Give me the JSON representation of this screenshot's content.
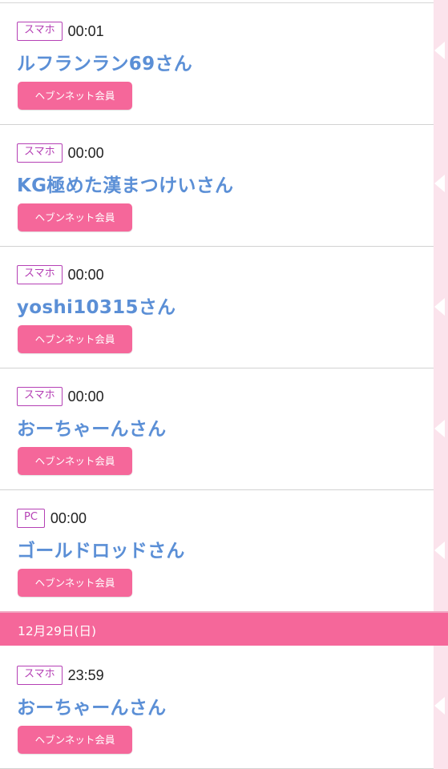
{
  "entries": [
    {
      "device": "スマホ",
      "time": "00:01",
      "name": "ルフランラン69さん",
      "member_label": "ヘブンネット会員"
    },
    {
      "device": "スマホ",
      "time": "00:00",
      "name": "KG極めた漢まつけいさん",
      "member_label": "ヘブンネット会員"
    },
    {
      "device": "スマホ",
      "time": "00:00",
      "name": "yoshi10315さん",
      "member_label": "ヘブンネット会員"
    },
    {
      "device": "スマホ",
      "time": "00:00",
      "name": "おーちゃーんさん",
      "member_label": "ヘブンネット会員"
    },
    {
      "device": "PC",
      "time": "00:00",
      "name": "ゴールドロッドさん",
      "member_label": "ヘブンネット会員"
    }
  ],
  "date_header": "12月29日(日)",
  "entries_after": [
    {
      "device": "スマホ",
      "time": "23:59",
      "name": "おーちゃーんさん",
      "member_label": "ヘブンネット会員"
    }
  ],
  "colors": {
    "accent_pink": "#f5679a",
    "device_badge": "#b540b5",
    "user_name": "#5b8fd6",
    "side_strip": "#fbe3ec"
  }
}
